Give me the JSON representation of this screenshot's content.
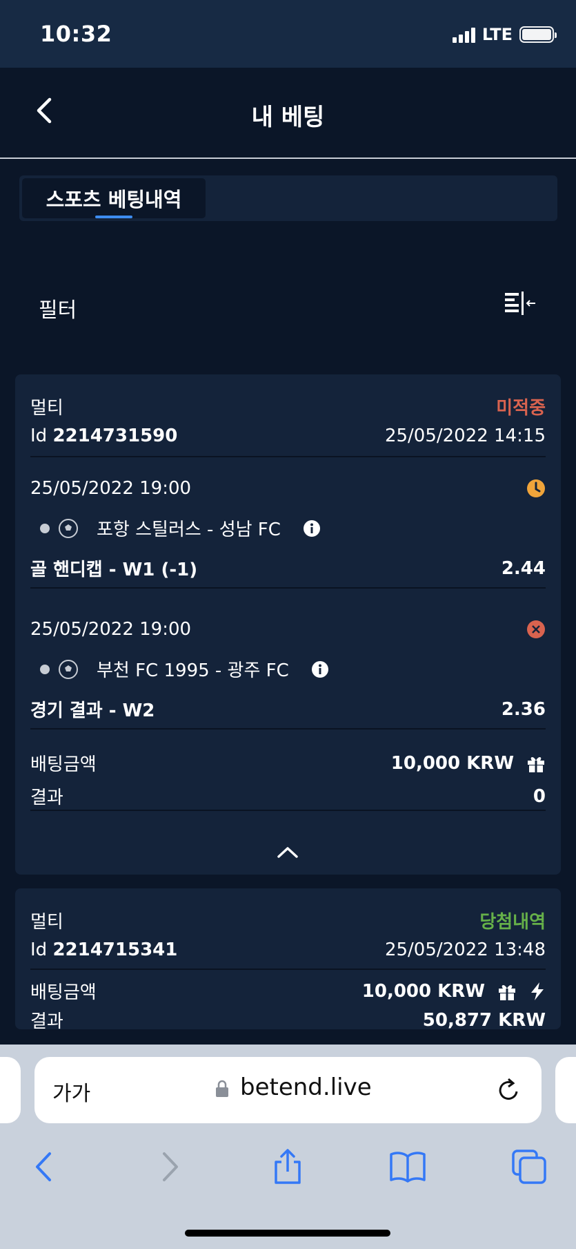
{
  "status_bar": {
    "time": "10:32",
    "network": "LTE"
  },
  "header": {
    "title": "내 베팅"
  },
  "tabs": [
    {
      "label": "스포츠 베팅내역",
      "active": true
    }
  ],
  "filter": {
    "label": "필터"
  },
  "bets": [
    {
      "type": "멀티",
      "status": "미적중",
      "status_color": "#d9634f",
      "id_label": "Id",
      "id": "2214731590",
      "placed_at": "25/05/2022 14:15",
      "selections": [
        {
          "datetime": "25/05/2022 19:00",
          "state_icon": "clock-icon",
          "match": "포항 스틸러스 - 성남 FC",
          "market": "골 핸디캡 - W1 (-1)",
          "odds": "2.44"
        },
        {
          "datetime": "25/05/2022 19:00",
          "state_icon": "cross-circle-icon",
          "match": "부천 FC 1995 - 광주 FC",
          "market": "경기 결과 - W2",
          "odds": "2.36"
        }
      ],
      "stake_label": "배팅금액",
      "stake": "10,000 KRW",
      "result_label": "결과",
      "result": "0"
    },
    {
      "type": "멀티",
      "status": "당첨내역",
      "status_color": "#66b049",
      "id_label": "Id",
      "id": "2214715341",
      "placed_at": "25/05/2022 13:48",
      "stake_label": "배팅금액",
      "stake": "10,000 KRW",
      "result_label": "결과",
      "result": "50,877 KRW"
    }
  ],
  "browser": {
    "text_size_label": "가가",
    "url": "betend.live"
  },
  "colors": {
    "background": "#0b1628",
    "card": "#14233a",
    "accent": "#3d8cf0",
    "pending_icon": "#f0a43a",
    "lost_icon": "#d9634f"
  }
}
